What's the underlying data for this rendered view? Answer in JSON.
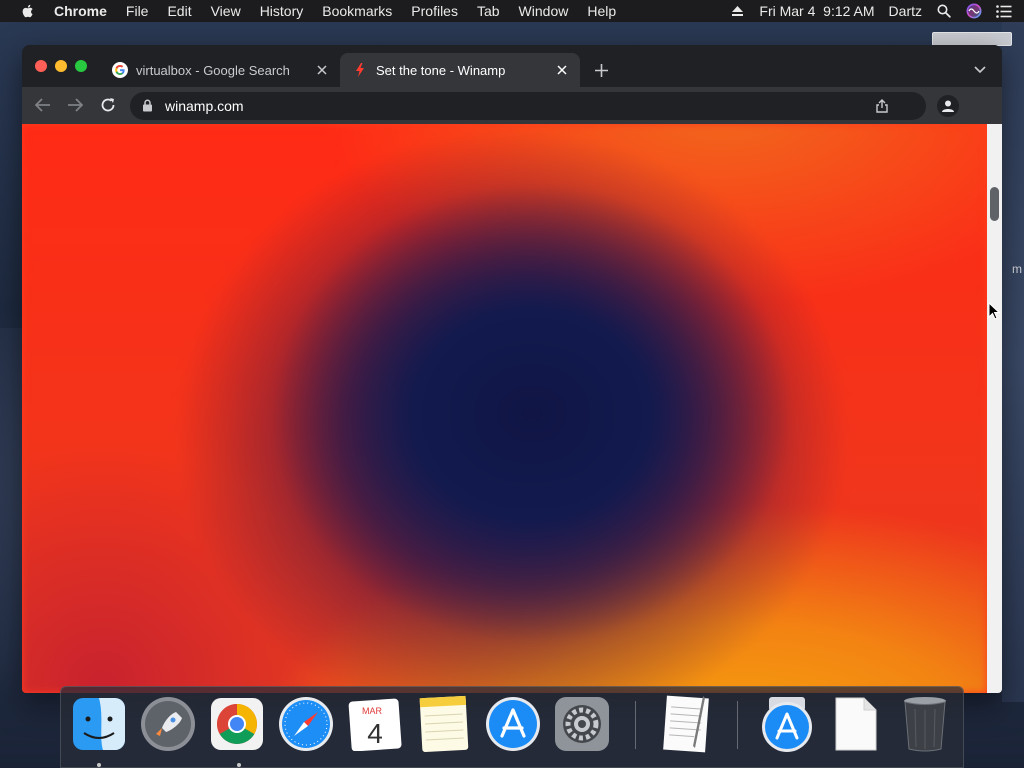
{
  "menubar": {
    "app_name": "Chrome",
    "items": [
      "File",
      "Edit",
      "View",
      "History",
      "Bookmarks",
      "Profiles",
      "Tab",
      "Window",
      "Help"
    ],
    "clock": "Fri Mar 4  9:12 AM",
    "user": "Dartz"
  },
  "browser": {
    "tabs": [
      {
        "title": "virtualbox - Google Search",
        "favicon": "google-icon",
        "active": false
      },
      {
        "title": "Set the tone - Winamp",
        "favicon": "winamp-icon",
        "active": true
      }
    ],
    "url": "winamp.com",
    "page": {
      "hero_colors": {
        "red": "#ff2a15",
        "orange": "#f7a20d",
        "navy": "#121a4e"
      },
      "scroll_position_fraction": 0.11
    }
  },
  "desktop": {
    "edge_text": "m"
  },
  "dock": {
    "items": [
      {
        "name": "Finder",
        "icon": "finder-icon",
        "running": true
      },
      {
        "name": "Launchpad",
        "icon": "launchpad-icon",
        "running": false
      },
      {
        "name": "Google Chrome",
        "icon": "chrome-icon",
        "running": true
      },
      {
        "name": "Safari",
        "icon": "safari-icon",
        "running": false
      },
      {
        "name": "Calendar",
        "icon": "calendar-icon",
        "running": false,
        "month": "MAR",
        "day": "4"
      },
      {
        "name": "Notes",
        "icon": "notes-icon",
        "running": false
      },
      {
        "name": "App Store",
        "icon": "app-store-icon",
        "running": false
      },
      {
        "name": "System Preferences",
        "icon": "system-preferences-icon",
        "running": false
      },
      {
        "name": "TextEdit",
        "icon": "textedit-icon",
        "running": false
      },
      {
        "name": "App Store Downloads",
        "icon": "app-store-stack-icon",
        "running": false
      },
      {
        "name": "Document",
        "icon": "document-icon",
        "running": false
      },
      {
        "name": "Trash",
        "icon": "trash-icon",
        "running": false
      }
    ]
  }
}
